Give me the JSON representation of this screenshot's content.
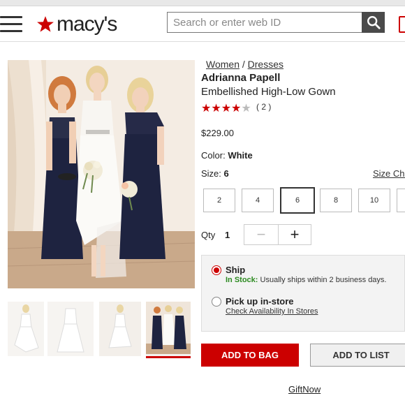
{
  "header": {
    "logo_text": "macy's",
    "search_placeholder": "Search or enter web ID",
    "brand_color": "#cc0000"
  },
  "breadcrumb": {
    "women": "Women",
    "sep": "/",
    "dresses": "Dresses"
  },
  "product": {
    "brand": "Adrianna Papell",
    "name": "Embellished High-Low Gown",
    "rating": 4,
    "rating_max": 5,
    "review_count": "( 2 )",
    "price": "$229.00",
    "color_label": "Color:",
    "color_value": "White",
    "size_label": "Size:",
    "size_value": "6",
    "size_chart": "Size Chart",
    "sizes": [
      "2",
      "4",
      "6",
      "8",
      "10"
    ],
    "selected_size": "6"
  },
  "quantity": {
    "label": "Qty",
    "value": "1",
    "minus": "−",
    "plus": "+"
  },
  "fulfillment": {
    "ship_title": "Ship",
    "ship_stock": "In Stock:",
    "ship_msg": " Usually ships within 2 business days.",
    "pickup_title": "Pick up in-store",
    "pickup_link": "Check Availability In Stores"
  },
  "actions": {
    "add_to_bag": "ADD TO BAG",
    "add_to_list": "ADD TO LIST",
    "giftnow": "GiftNow"
  },
  "colors": {
    "accent": "#cc0000",
    "instock": "#2b8a1f",
    "navy_dress": "#1e2340"
  }
}
